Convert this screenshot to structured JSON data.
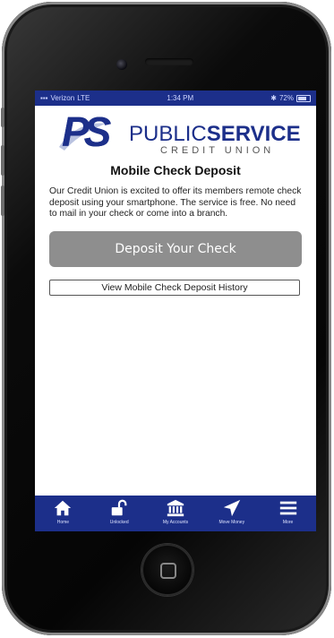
{
  "status_bar": {
    "carrier": "Verizon",
    "network": "LTE",
    "time": "1:34 PM",
    "battery": "72%"
  },
  "logo": {
    "mark": "PS",
    "word_public": "PUBLIC",
    "word_service": "SERVICE",
    "subtitle": "CREDIT UNION"
  },
  "page": {
    "title": "Mobile Check Deposit",
    "description": "Our Credit Union is excited to offer its members remote check deposit using your smartphone. The service is free. No need to mail in your check or come into a branch.",
    "deposit_button": "Deposit Your Check",
    "history_button": "View Mobile Check Deposit History"
  },
  "tabs": [
    {
      "label": "Home",
      "icon": "home-icon"
    },
    {
      "label": "Unlocked",
      "icon": "unlocked-padlock-icon"
    },
    {
      "label": "My Accounts",
      "icon": "bank-icon"
    },
    {
      "label": "Move Money",
      "icon": "paper-plane-icon"
    },
    {
      "label": "More",
      "icon": "hamburger-menu-icon"
    }
  ],
  "colors": {
    "brand_blue": "#1c2f8a",
    "deposit_button_gray": "#8e8e8e"
  }
}
